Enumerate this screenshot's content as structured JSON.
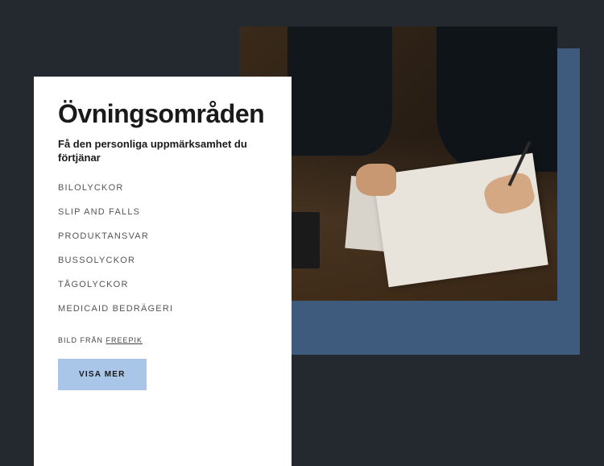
{
  "heading": "Övningsområden",
  "subtitle": "Få den personliga uppmärksamhet du förtjänar",
  "items": [
    "BILOLYCKOR",
    "SLIP AND FALLS",
    "PRODUKTANSVAR",
    "BUSSOLYCKOR",
    "TÅGOLYCKOR",
    "MEDICAID BEDRÄGERI"
  ],
  "credit_prefix": "BILD FRÅN ",
  "credit_link": "FREEPIK",
  "button_label": "VISA MER"
}
